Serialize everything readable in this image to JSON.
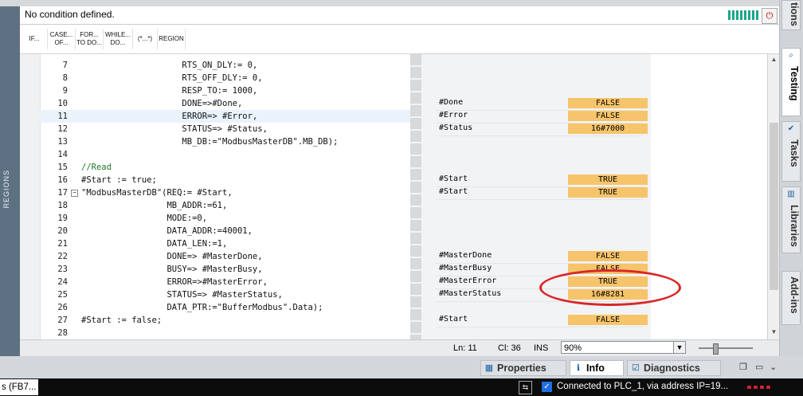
{
  "condition_bar": {
    "text": "No condition defined."
  },
  "toolbar": {
    "buttons": [
      {
        "label": "IF..."
      },
      {
        "label": "CASE... OF..."
      },
      {
        "label": "FOR... TO DO..."
      },
      {
        "label": "WHILE... DO..."
      },
      {
        "label": "(*...*)"
      },
      {
        "label": "REGION"
      }
    ]
  },
  "left_rail": {
    "label": "REGIONS"
  },
  "code_lines": [
    {
      "num": "7",
      "text": "                    RTS_ON_DLY:= 0,"
    },
    {
      "num": "8",
      "text": "                    RTS_OFF_DLY:= 0,"
    },
    {
      "num": "9",
      "text": "                    RESP_TO:= 1000,"
    },
    {
      "num": "10",
      "text": "                    DONE=>#Done,"
    },
    {
      "num": "11",
      "text": "                    ERROR=> #Error,"
    },
    {
      "num": "12",
      "text": "                    STATUS=> #Status,"
    },
    {
      "num": "13",
      "text": "                    MB_DB:=\"ModbusMasterDB\".MB_DB);"
    },
    {
      "num": "14",
      "text": ""
    },
    {
      "num": "15",
      "text": "//Read"
    },
    {
      "num": "16",
      "text": "#Start := true;"
    },
    {
      "num": "17",
      "text": "\"ModbusMasterDB\"(REQ:= #Start,"
    },
    {
      "num": "18",
      "text": "                 MB_ADDR:=61,"
    },
    {
      "num": "19",
      "text": "                 MODE:=0,"
    },
    {
      "num": "20",
      "text": "                 DATA_ADDR:=40001,"
    },
    {
      "num": "21",
      "text": "                 DATA_LEN:=1,"
    },
    {
      "num": "22",
      "text": "                 DONE=> #MasterDone,"
    },
    {
      "num": "23",
      "text": "                 BUSY=> #MasterBusy,"
    },
    {
      "num": "24",
      "text": "                 ERROR=>#MasterError,"
    },
    {
      "num": "25",
      "text": "                 STATUS=> #MasterStatus,"
    },
    {
      "num": "26",
      "text": "                 DATA_PTR:=\"BufferModbus\".Data);"
    },
    {
      "num": "27",
      "text": "#Start := false;"
    },
    {
      "num": "28",
      "text": ""
    }
  ],
  "watch": [
    {
      "var": "#Done",
      "value": "FALSE"
    },
    {
      "var": "#Error",
      "value": "FALSE"
    },
    {
      "var": "#Status",
      "value": "16#7000"
    },
    {
      "var": "#Start",
      "value": "TRUE"
    },
    {
      "var": "#Start",
      "value": "TRUE"
    },
    {
      "var": "#MasterDone",
      "value": "FALSE"
    },
    {
      "var": "#MasterBusy",
      "value": "FALSE"
    },
    {
      "var": "#MasterError",
      "value": "TRUE"
    },
    {
      "var": "#MasterStatus",
      "value": "16#8281"
    },
    {
      "var": "#Start",
      "value": "FALSE"
    }
  ],
  "status_bar": {
    "ln": "Ln: 11",
    "cl": "Cl: 36",
    "mode": "INS",
    "zoom": "90%"
  },
  "bottom_tabs": {
    "properties": "Properties",
    "info": "Info",
    "diagnostics": "Diagnostics"
  },
  "right_tabs": {
    "top_partial": "tions",
    "testing": "Testing",
    "tasks": "Tasks",
    "libraries": "Libraries",
    "addins": "Add-ins"
  },
  "taskbar": {
    "item": "s (FB7...",
    "connection": "Connected to PLC_1, via address IP=19..."
  },
  "colors": {
    "value_highlight": "#f6c46a",
    "annotation_circle": "#d92626",
    "rail": "#5e7182"
  }
}
